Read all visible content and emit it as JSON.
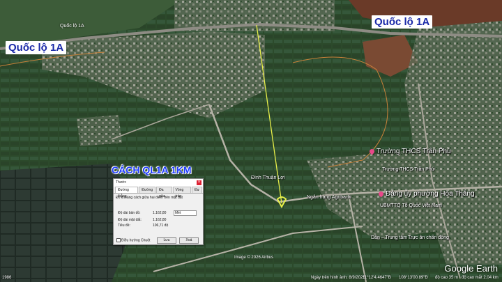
{
  "map": {
    "road_labels": [
      "Quốc lộ 1A",
      "Quốc lộ 1A"
    ],
    "small_road_label": "Quốc lộ 1A",
    "annotation": "CÁCH QL1A 1KM",
    "places": {
      "school": "Trường THCS Trần Phú",
      "school2": "Trường THCS Trần Phú",
      "party": "Đảng ủy phường Hòa Thắng",
      "front": "UBMTTQ Tổ Quốc Việt Nam",
      "temple": "Đình Thuận Lợi",
      "bank": "Ngân hàng Agribank",
      "center": "Dân – Trung tâm ...",
      "center2": "Trực ân chấn đông"
    },
    "image_credit": "Image © 2026 Airbus",
    "logo": "Google Earth",
    "accent_line_color": "#e8f04a"
  },
  "ruler": {
    "title": "Thước",
    "tabs": [
      "Đường thẳng",
      "Đường",
      "Đa giác",
      "Vòng tròn",
      "Đư"
    ],
    "description": "Đo khoảng cách giữa hai điểm trên mặt đất",
    "map_length_label": "Độ dài bản đồ:",
    "map_length_value": "1.162,80",
    "unit": "Mét",
    "ground_length_label": "Độ dài mặt đất:",
    "ground_length_value": "1.162,80",
    "heading_label": "Tiêu đề:",
    "heading_value": "106,71 độ",
    "mouse_nav_label": "Điều hướng Chuột",
    "save_label": "Lưu",
    "clear_label": "Xoá"
  },
  "status": {
    "left": "1986",
    "date": "Ngày trên hình ảnh: 8/9/2025",
    "lat": "11°12'4.4647\"B",
    "lon": "108°13'00.89\"Đ",
    "elev": "độ cao 35 m",
    "eye": "độ cao mắt 2.04 km"
  }
}
